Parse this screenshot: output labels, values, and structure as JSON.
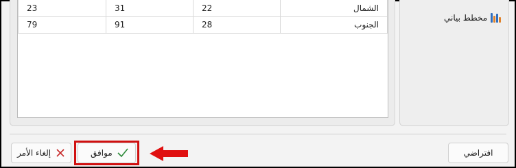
{
  "sidebar": {
    "items": [
      {
        "label": "مخطط بياني",
        "icon": "bar-chart-icon"
      }
    ]
  },
  "table": {
    "rows": [
      {
        "name": "الشمال",
        "values": [
          "22",
          "31",
          "23"
        ]
      },
      {
        "name": "الجنوب",
        "values": [
          "28",
          "91",
          "79"
        ]
      }
    ]
  },
  "footer": {
    "default_label": "افتراضي",
    "ok_label": "موافق",
    "cancel_label": "إلغاء الأمر"
  },
  "colors": {
    "highlight": "#d01010",
    "ok_check": "#2e8b3a",
    "cancel_x": "#c62828",
    "chart_bars": [
      "#e0822a",
      "#2f6fc0",
      "#e0822a",
      "#2f6fc0"
    ]
  }
}
